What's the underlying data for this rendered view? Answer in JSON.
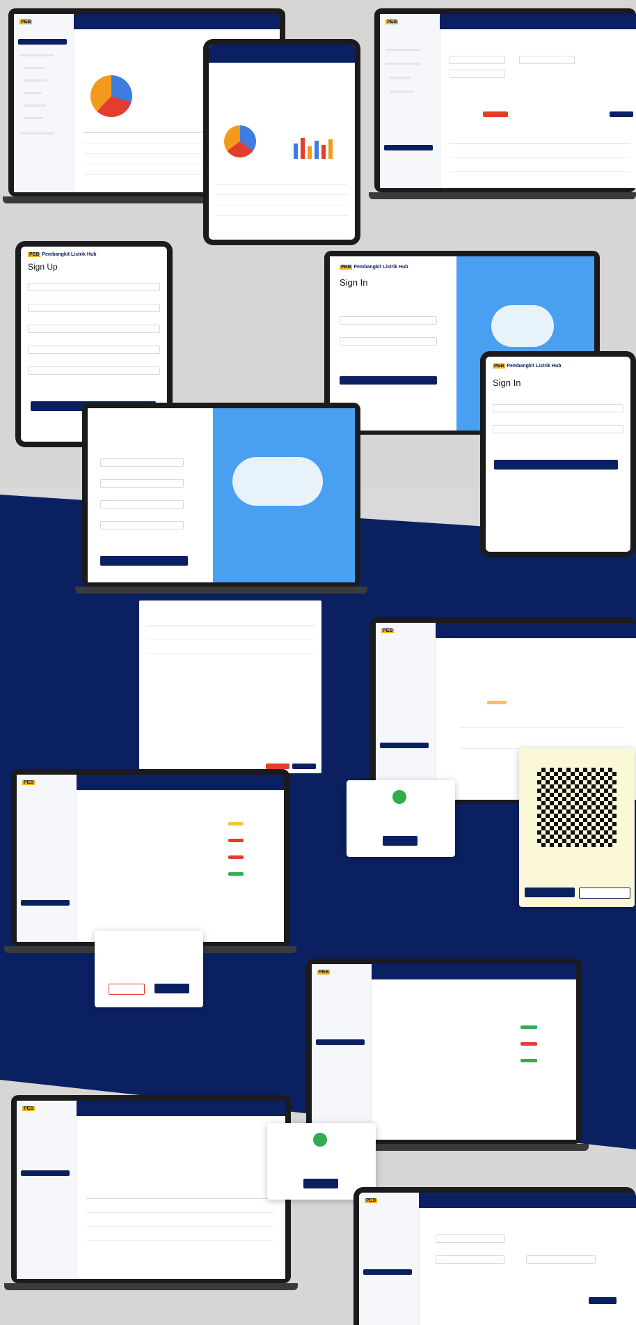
{
  "brand": {
    "logo_mark": "PEB",
    "app_name": "Pembangkit Listrik Hub"
  },
  "signin": {
    "title": "Sign In"
  },
  "signup": {
    "title": "Sign Up"
  },
  "colors": {
    "navy": "#0b2060",
    "accent": "#4aa0f0",
    "background": "#d7d6d5"
  }
}
